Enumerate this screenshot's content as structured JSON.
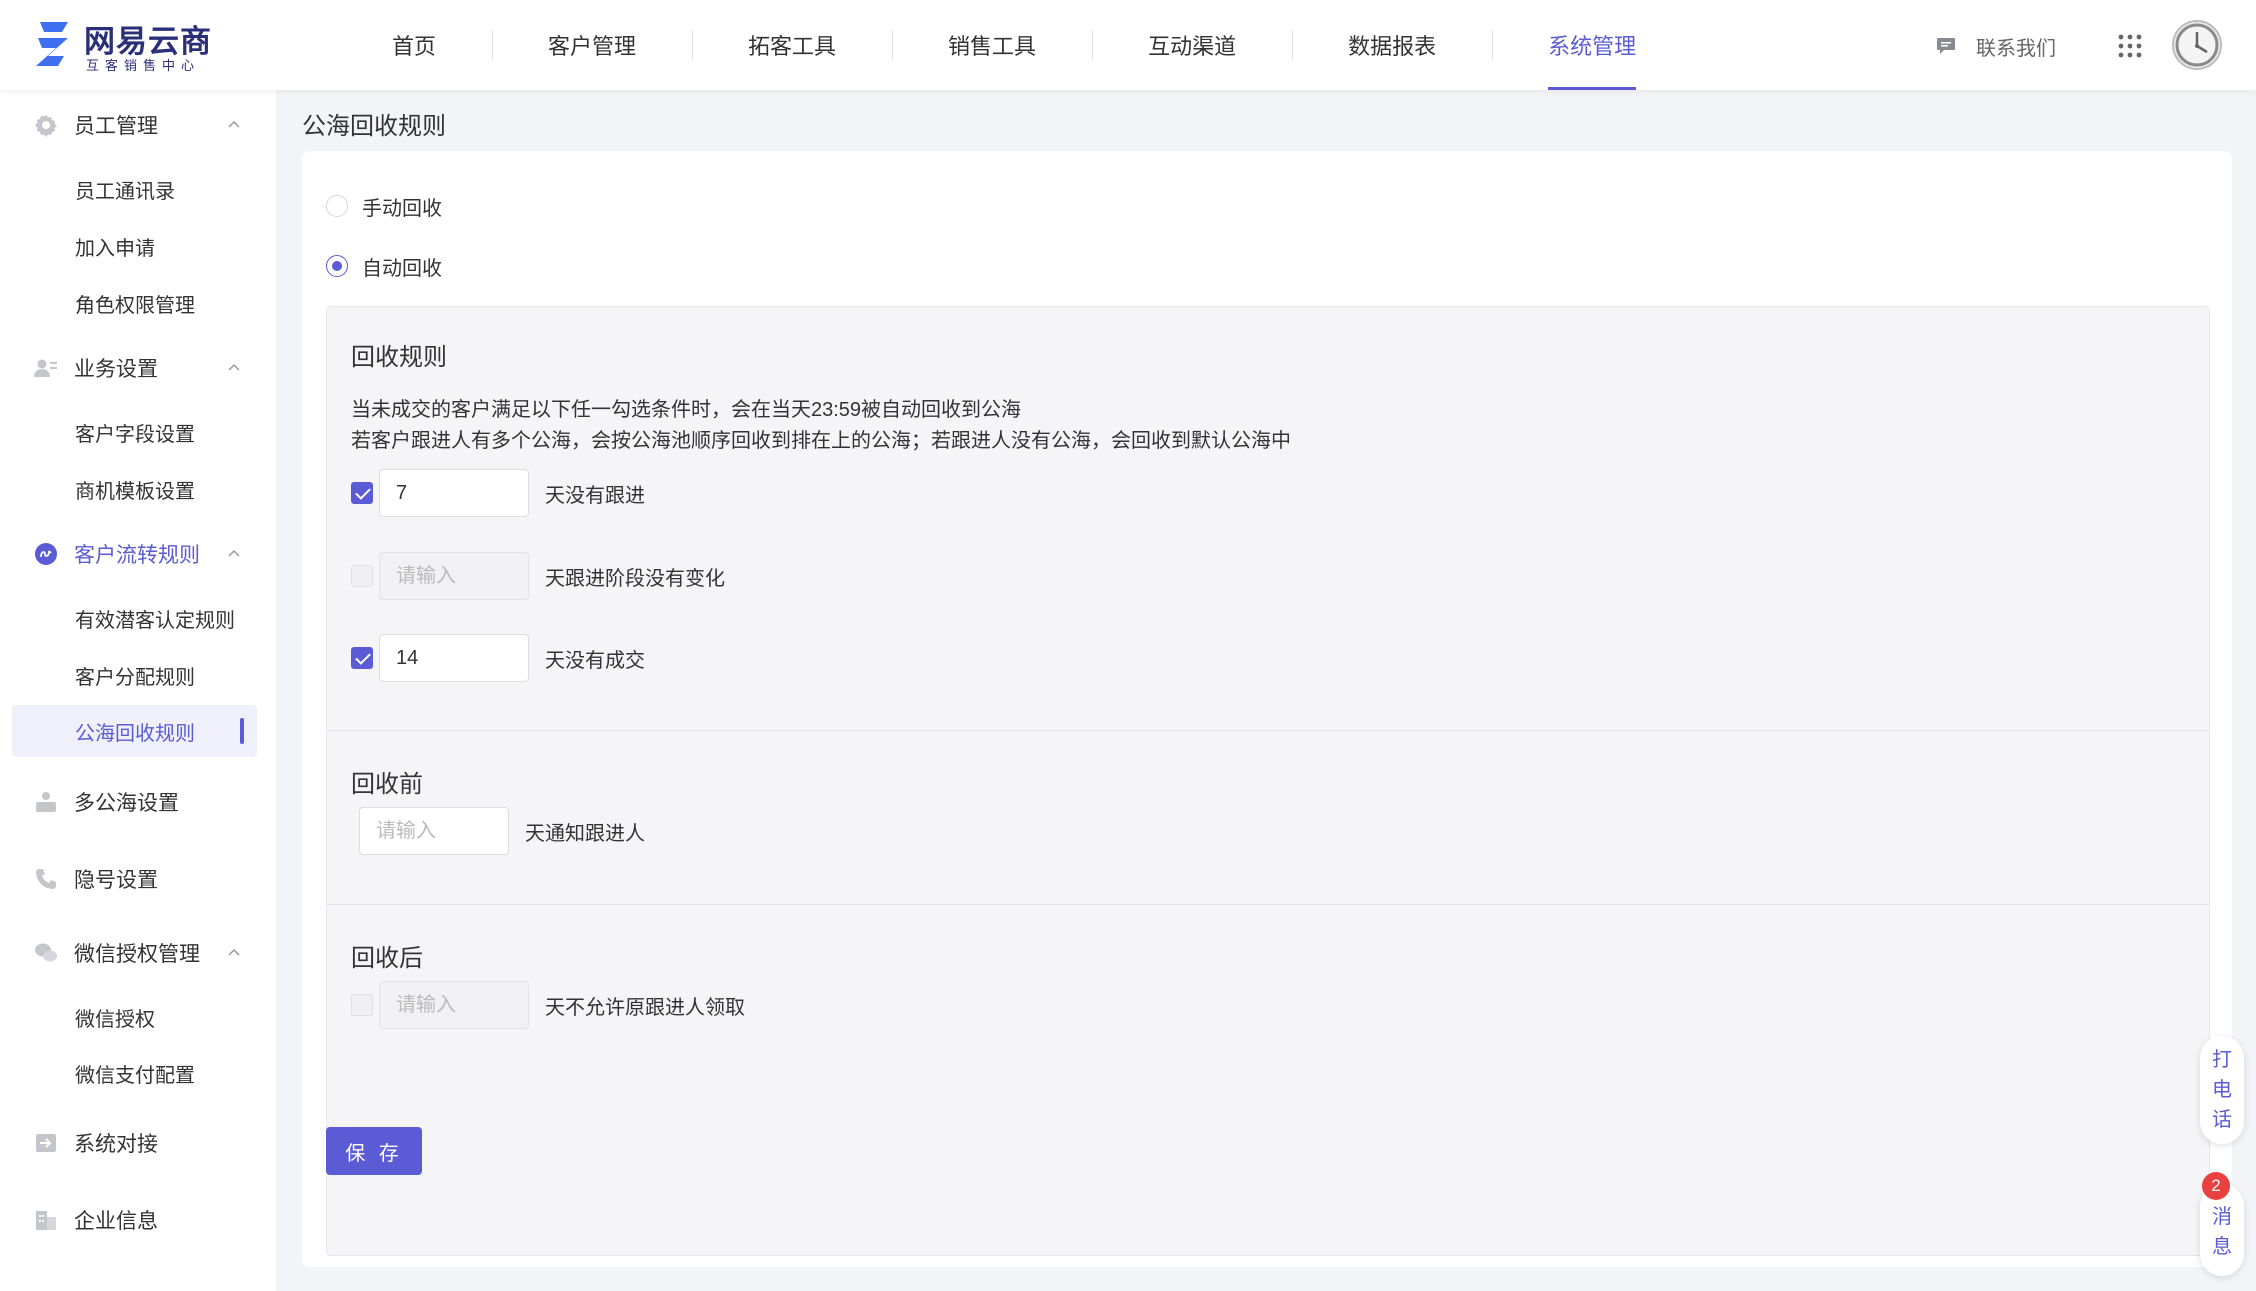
{
  "brand": {
    "title": "网易云商",
    "subtitle": "互客销售中心",
    "color": "#2b2f7a"
  },
  "accent_color": "#5b5bd6",
  "nav": {
    "items": [
      {
        "label": "首页",
        "active": false
      },
      {
        "label": "客户管理",
        "active": false
      },
      {
        "label": "拓客工具",
        "active": false
      },
      {
        "label": "销售工具",
        "active": false
      },
      {
        "label": "互动渠道",
        "active": false
      },
      {
        "label": "数据报表",
        "active": false
      },
      {
        "label": "系统管理",
        "active": true
      }
    ],
    "contact_label": "联系我们",
    "contact_icon": "chat-icon",
    "apps_icon": "grid-apps-icon",
    "avatar_icon": "user-avatar"
  },
  "sidebar": {
    "groups": [
      {
        "label": "员工管理",
        "icon": "gear-icon",
        "expanded": true,
        "items": [
          {
            "label": "员工通讯录"
          },
          {
            "label": "加入申请"
          },
          {
            "label": "角色权限管理"
          }
        ]
      },
      {
        "label": "业务设置",
        "icon": "user-list-icon",
        "expanded": true,
        "items": [
          {
            "label": "客户字段设置"
          },
          {
            "label": "商机模板设置"
          }
        ]
      },
      {
        "label": "客户流转规则",
        "icon": "flow-icon",
        "expanded": true,
        "active": true,
        "items": [
          {
            "label": "有效潜客认定规则"
          },
          {
            "label": "客户分配规则"
          },
          {
            "label": "公海回收规则",
            "active": true
          }
        ]
      },
      {
        "label": "多公海设置",
        "icon": "users-icon"
      },
      {
        "label": "隐号设置",
        "icon": "phone-icon"
      },
      {
        "label": "微信授权管理",
        "icon": "wechat-icon",
        "expanded": true,
        "items": [
          {
            "label": "微信授权"
          },
          {
            "label": "微信支付配置"
          }
        ]
      },
      {
        "label": "系统对接",
        "icon": "plug-in-icon"
      },
      {
        "label": "企业信息",
        "icon": "building-icon"
      }
    ]
  },
  "main": {
    "page_title": "公海回收规则",
    "recycle_mode": {
      "options": [
        {
          "label": "手动回收",
          "checked": false
        },
        {
          "label": "自动回收",
          "checked": true
        }
      ]
    },
    "rules": {
      "title": "回收规则",
      "desc_line1": "当未成交的客户满足以下任一勾选条件时，会在当天23:59被自动回收到公海",
      "desc_line2": "若客户跟进人有多个公海，会按公海池顺序回收到排在上的公海；若跟进人没有公海，会回收到默认公海中",
      "conditions": [
        {
          "checked": true,
          "value": "7",
          "placeholder": "请输入",
          "suffix": "天没有跟进",
          "enabled": true
        },
        {
          "checked": false,
          "value": "",
          "placeholder": "请输入",
          "suffix": "天跟进阶段没有变化",
          "enabled": false
        },
        {
          "checked": true,
          "value": "14",
          "placeholder": "请输入",
          "suffix": "天没有成交",
          "enabled": true
        }
      ]
    },
    "before": {
      "title": "回收前",
      "placeholder": "请输入",
      "value": "",
      "suffix": "天通知跟进人"
    },
    "after": {
      "title": "回收后",
      "checked": false,
      "placeholder": "请输入",
      "value": "",
      "suffix": "天不允许原跟进人领取"
    },
    "save_label": "保 存"
  },
  "floating": {
    "call_label": "打电话",
    "message_label": "消息",
    "message_badge": "2"
  }
}
